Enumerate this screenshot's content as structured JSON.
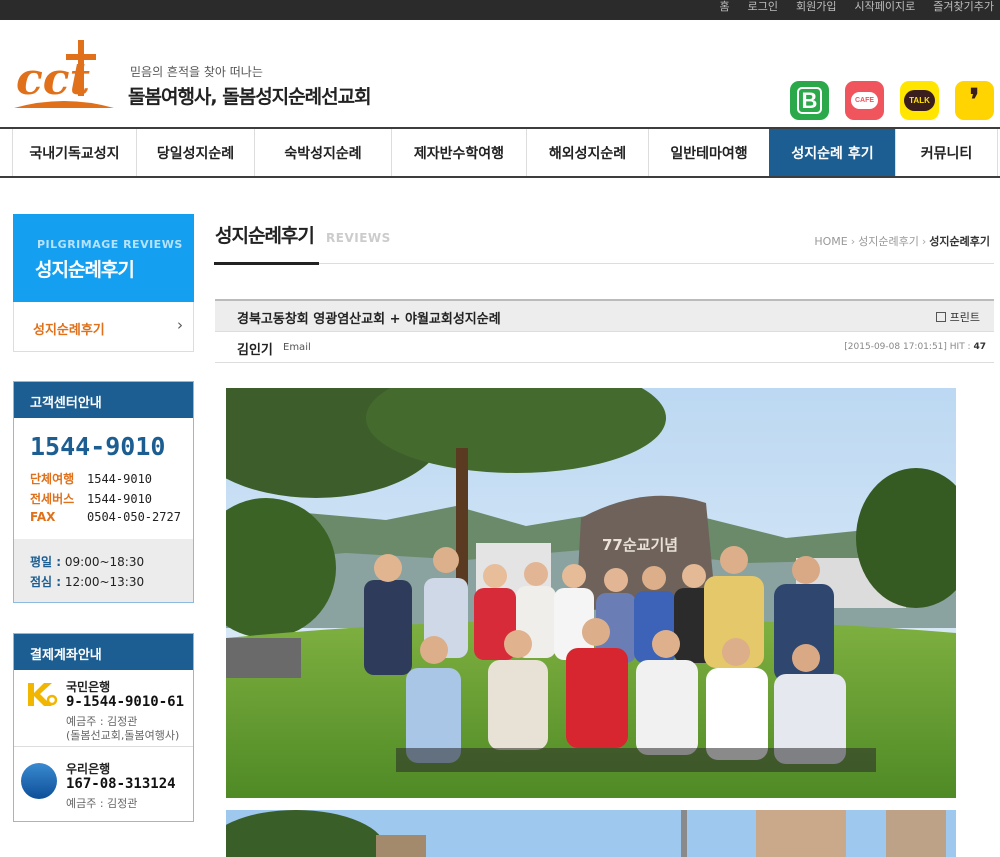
{
  "topbar": {
    "links": [
      "홈",
      "로그인",
      "회원가입",
      "시작페이지로",
      "즐겨찾기추가"
    ]
  },
  "header": {
    "logo_text": "cct",
    "tagline": "믿음의 흔적을 찾아 떠나는",
    "site_name": "돌봄여행사, 돌봄성지순례선교회",
    "sns": [
      {
        "name": "blog",
        "label": "B",
        "color": "#2aa84a"
      },
      {
        "name": "cafe",
        "label": "CAFE",
        "color": "#f0555d"
      },
      {
        "name": "talk",
        "label": "TALK",
        "color": "#ffe500"
      },
      {
        "name": "story",
        "label": "❜",
        "color": "#ffd400"
      }
    ]
  },
  "gnb": [
    {
      "label": "국내기독교성지",
      "active": false
    },
    {
      "label": "당일성지순례",
      "active": false
    },
    {
      "label": "숙박성지순례",
      "active": false
    },
    {
      "label": "제자반수학여행",
      "active": false
    },
    {
      "label": "해외성지순례",
      "active": false
    },
    {
      "label": "일반테마여행",
      "active": false
    },
    {
      "label": "성지순례 후기",
      "active": true
    },
    {
      "label": "커뮤니티",
      "active": false
    }
  ],
  "lnb": {
    "title_en": "PILGRIMAGE REVIEWS",
    "title_ko": "성지순례후기",
    "item": "성지순례후기"
  },
  "customer_center": {
    "title": "고객센터안내",
    "main_phone": "1544-9010",
    "rows": [
      {
        "label": "단체여행",
        "value": "1544-9010"
      },
      {
        "label": "전세버스",
        "value": "1544-9010"
      },
      {
        "label": "FAX",
        "value": "0504-050-2727"
      }
    ],
    "hours": [
      {
        "label": "평일 :",
        "value": "09:00~18:30"
      },
      {
        "label": "점심 :",
        "value": "12:00~13:30"
      }
    ]
  },
  "bank_info": {
    "title": "결제계좌안내",
    "accounts": [
      {
        "bank": "국민은행",
        "number": "9-1544-9010-61",
        "owner_lines": [
          "예금주 : 김정관",
          "(돌봄선교회,돌봄여행사)"
        ]
      },
      {
        "bank": "우리은행",
        "number": "167-08-313124",
        "owner_lines": [
          "예금주 : 김정관"
        ]
      }
    ]
  },
  "content": {
    "title": "성지순례후기",
    "title_en": "REVIEWS",
    "breadcrumb": [
      "HOME",
      "성지순례후기",
      "성지순례후기"
    ],
    "post": {
      "title": "경북고동창회 영광염산교회 + 야월교회성지순례",
      "print_label": "프린트",
      "author": "김인기",
      "email_label": "Email",
      "date": "[2015-09-08 17:01:51]",
      "hit_label": "HIT :",
      "hit_value": "47",
      "monument_text": "77순교기념"
    }
  }
}
